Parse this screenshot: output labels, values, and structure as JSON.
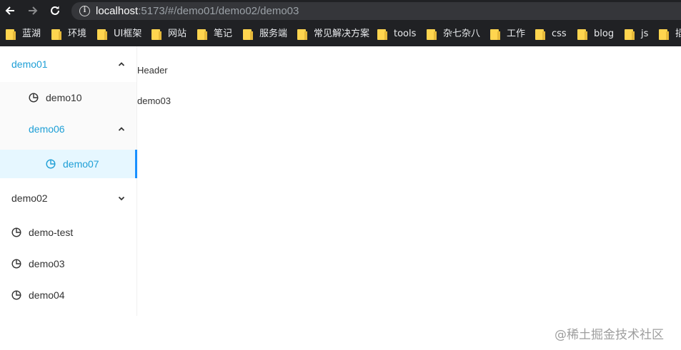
{
  "browser": {
    "url_host": "localhost",
    "url_path": ":5173/#/demo01/demo02/demo03",
    "info_icon_glyph": "i",
    "bookmarks": [
      "蓝湖",
      "环境",
      "UI框架",
      "网站",
      "笔记",
      "服务端",
      "常见解决方案",
      "tools",
      "杂七杂八",
      "工作",
      "css",
      "blog",
      "js",
      "插"
    ]
  },
  "sidebar": {
    "demo01": "demo01",
    "demo10": "demo10",
    "demo06": "demo06",
    "demo07": "demo07",
    "demo02": "demo02",
    "demo_test": "demo-test",
    "demo03": "demo03",
    "demo04": "demo04"
  },
  "content": {
    "header": "Header",
    "body": "demo03"
  },
  "watermark": "@稀土掘金技术社区",
  "colors": {
    "chrome_bg": "#202124",
    "omnibox_bg": "#35363a",
    "active": "#1e9fd6",
    "active_bg": "#e6f7ff",
    "active_border": "#1890ff",
    "submenu_bg": "#fafafa"
  }
}
